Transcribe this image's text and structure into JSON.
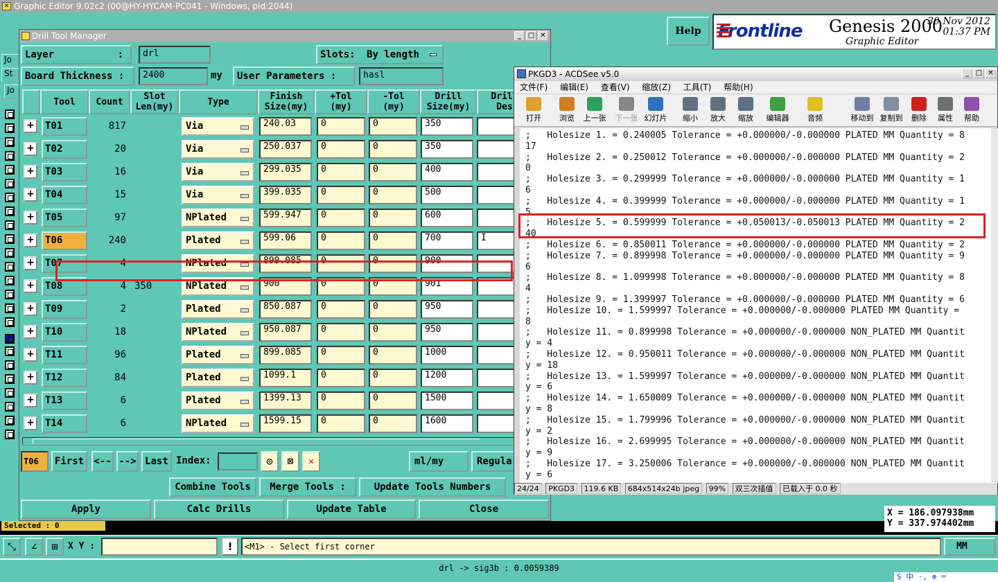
{
  "window": {
    "title": "Graphic Editor 9.02c2 (00@HY-HYCAM-PC041 - Windows, pid:2044)"
  },
  "header": {
    "help_label": "Help",
    "logo_text": "Frontline",
    "product_name": "Genesis 2000",
    "product_sub": "Graphic Editor",
    "date": "30 Nov 2012",
    "time": "01:37 PM"
  },
  "left_tabs": [
    "Jo",
    "St",
    "Jo"
  ],
  "drill_manager": {
    "title": "Drill Tool Manager",
    "layer_label": "Layer",
    "layer_colon": ":",
    "layer_value": "drl",
    "slots_label": "Slots:",
    "slots_value": "By length",
    "board_thickness_label": "Board Thickness :",
    "board_thickness_value": "2400",
    "board_thickness_unit": "my",
    "user_params_label": "User Parameters :",
    "user_params_value": "hasl",
    "columns": [
      "Tool",
      "Count",
      "Slot\nLen(my)",
      "Type",
      "Finish\nSize(my)",
      "+Tol\n(my)",
      "-Tol\n(my)",
      "Drill\nSize(my)",
      "Drill\nDes"
    ],
    "rows": [
      {
        "tool": "T01",
        "count": "817",
        "slot": "",
        "type": "Via",
        "finish": "240.03",
        "ptol": "0",
        "mtol": "0",
        "drill": "350",
        "des": ""
      },
      {
        "tool": "T02",
        "count": "20",
        "slot": "",
        "type": "Via",
        "finish": "250.037",
        "ptol": "0",
        "mtol": "0",
        "drill": "350",
        "des": ""
      },
      {
        "tool": "T03",
        "count": "16",
        "slot": "",
        "type": "Via",
        "finish": "299.035",
        "ptol": "0",
        "mtol": "0",
        "drill": "400",
        "des": ""
      },
      {
        "tool": "T04",
        "count": "15",
        "slot": "",
        "type": "Via",
        "finish": "399.035",
        "ptol": "0",
        "mtol": "0",
        "drill": "500",
        "des": ""
      },
      {
        "tool": "T05",
        "count": "97",
        "slot": "",
        "type": "NPlated",
        "finish": "599.947",
        "ptol": "0",
        "mtol": "0",
        "drill": "600",
        "des": ""
      },
      {
        "tool": "T06",
        "count": "240",
        "slot": "",
        "type": "Plated",
        "finish": "599.06",
        "ptol": "0",
        "mtol": "0",
        "drill": "700",
        "des": "I"
      },
      {
        "tool": "T07",
        "count": "4",
        "slot": "",
        "type": "NPlated",
        "finish": "899.085",
        "ptol": "0",
        "mtol": "0",
        "drill": "900",
        "des": ""
      },
      {
        "tool": "T08",
        "count": "4",
        "slot": "350",
        "type": "NPlated",
        "finish": "900",
        "ptol": "0",
        "mtol": "0",
        "drill": "901",
        "des": ""
      },
      {
        "tool": "T09",
        "count": "2",
        "slot": "",
        "type": "Plated",
        "finish": "850.087",
        "ptol": "0",
        "mtol": "0",
        "drill": "950",
        "des": ""
      },
      {
        "tool": "T10",
        "count": "18",
        "slot": "",
        "type": "NPlated",
        "finish": "950.087",
        "ptol": "0",
        "mtol": "0",
        "drill": "950",
        "des": ""
      },
      {
        "tool": "T11",
        "count": "96",
        "slot": "",
        "type": "Plated",
        "finish": "899.085",
        "ptol": "0",
        "mtol": "0",
        "drill": "1000",
        "des": ""
      },
      {
        "tool": "T12",
        "count": "84",
        "slot": "",
        "type": "Plated",
        "finish": "1099.1",
        "ptol": "0",
        "mtol": "0",
        "drill": "1200",
        "des": ""
      },
      {
        "tool": "T13",
        "count": "6",
        "slot": "",
        "type": "Plated",
        "finish": "1399.13",
        "ptol": "0",
        "mtol": "0",
        "drill": "1500",
        "des": ""
      },
      {
        "tool": "T14",
        "count": "6",
        "slot": "",
        "type": "NPlated",
        "finish": "1599.15",
        "ptol": "0",
        "mtol": "0",
        "drill": "1600",
        "des": ""
      }
    ],
    "nav": {
      "current_tool": "T06",
      "first": "First",
      "prev": "<--",
      "next": "-->",
      "last": "Last",
      "index_label": "Index:",
      "units": "ml/my",
      "regular": "Regula"
    },
    "actions": {
      "combine": "Combine Tools",
      "merge": "Merge Tools :",
      "update_numbers": "Update Tools Numbers",
      "apply": "Apply",
      "calc": "Calc Drills",
      "update_table": "Update Table",
      "close": "Close"
    }
  },
  "acdsee": {
    "title": "PKGD3 - ACDSee v5.0",
    "menu": [
      "文件(F)",
      "编辑(E)",
      "查看(V)",
      "缩放(Z)",
      "工具(T)",
      "帮助(H)"
    ],
    "toolbar": [
      "打开",
      "浏览",
      "上一张",
      "下一张",
      "幻灯片",
      "缩小",
      "放大",
      "缩放",
      "编辑器",
      "音频",
      "移动到",
      "复制到",
      "删除",
      "属性",
      "帮助"
    ],
    "lines": [
      ";   Holesize 1. = 0.240005 Tolerance = +0.000000/-0.000000 PLATED MM Quantity = 8",
      "17",
      ";   Holesize 2. = 0.250012 Tolerance = +0.000000/-0.000000 PLATED MM Quantity = 2",
      "0",
      ";   Holesize 3. = 0.299999 Tolerance = +0.000000/-0.000000 PLATED MM Quantity = 1",
      "6",
      ";   Holesize 4. = 0.399999 Tolerance = +0.000000/-0.000000 PLATED MM Quantity = 1",
      "5",
      ";   Holesize 5. = 0.599999 Tolerance = +0.050013/-0.050013 PLATED MM Quantity = 2",
      "40",
      ";   Holesize 6. = 0.850011 Tolerance = +0.000000/-0.000000 PLATED MM Quantity = 2",
      ";   Holesize 7. = 0.899998 Tolerance = +0.000000/-0.000000 PLATED MM Quantity = 9",
      "6",
      ";   Holesize 8. = 1.099998 Tolerance = +0.000000/-0.000000 PLATED MM Quantity = 8",
      "4",
      ";   Holesize 9. = 1.399997 Tolerance = +0.000000/-0.000000 PLATED MM Quantity = 6",
      ";   Holesize 10. = 1.599997 Tolerance = +0.000000/-0.000000 PLATED MM Quantity =",
      "8",
      ";   Holesize 11. = 0.899998 Tolerance = +0.000000/-0.000000 NON_PLATED MM Quantit",
      "y = 4",
      ";   Holesize 12. = 0.950011 Tolerance = +0.000000/-0.000000 NON_PLATED MM Quantit",
      "y = 18",
      ";   Holesize 13. = 1.599997 Tolerance = +0.000000/-0.000000 NON_PLATED MM Quantit",
      "y = 6",
      ";   Holesize 14. = 1.650009 Tolerance = +0.000000/-0.000000 NON_PLATED MM Quantit",
      "y = 8",
      ";   Holesize 15. = 1.799996 Tolerance = +0.000000/-0.000000 NON_PLATED MM Quantit",
      "y = 2",
      ";   Holesize 16. = 2.699995 Tolerance = +0.000000/-0.000000 NON_PLATED MM Quantit",
      "y = 9",
      ";   Holesize 17. = 3.250006 Tolerance = +0.000000/-0.000000 NON_PLATED MM Quantit",
      "y = 6"
    ],
    "status": [
      "24/24",
      "PKGD3",
      "119.6 KB",
      "684x514x24b jpeg",
      "99%",
      "双三次插值",
      "已载入于 0.0 秒"
    ]
  },
  "bottom": {
    "selected": "Selected : 0",
    "coord_x": "X = 186.097938mm",
    "coord_y": "Y = 337.974402mm",
    "xy_label": "X Y :",
    "bang": "!",
    "prompt": "<M1> - Select first corner",
    "units": "MM",
    "status": "drl -> sig3b : 0.0059389",
    "tray": "S 中 ·, ⊕ ⌨"
  },
  "colors": {
    "panel": "#5fc8b4",
    "highlight": "#e02020",
    "selected_tool": "#f0b040",
    "field": "#fff8d0"
  }
}
